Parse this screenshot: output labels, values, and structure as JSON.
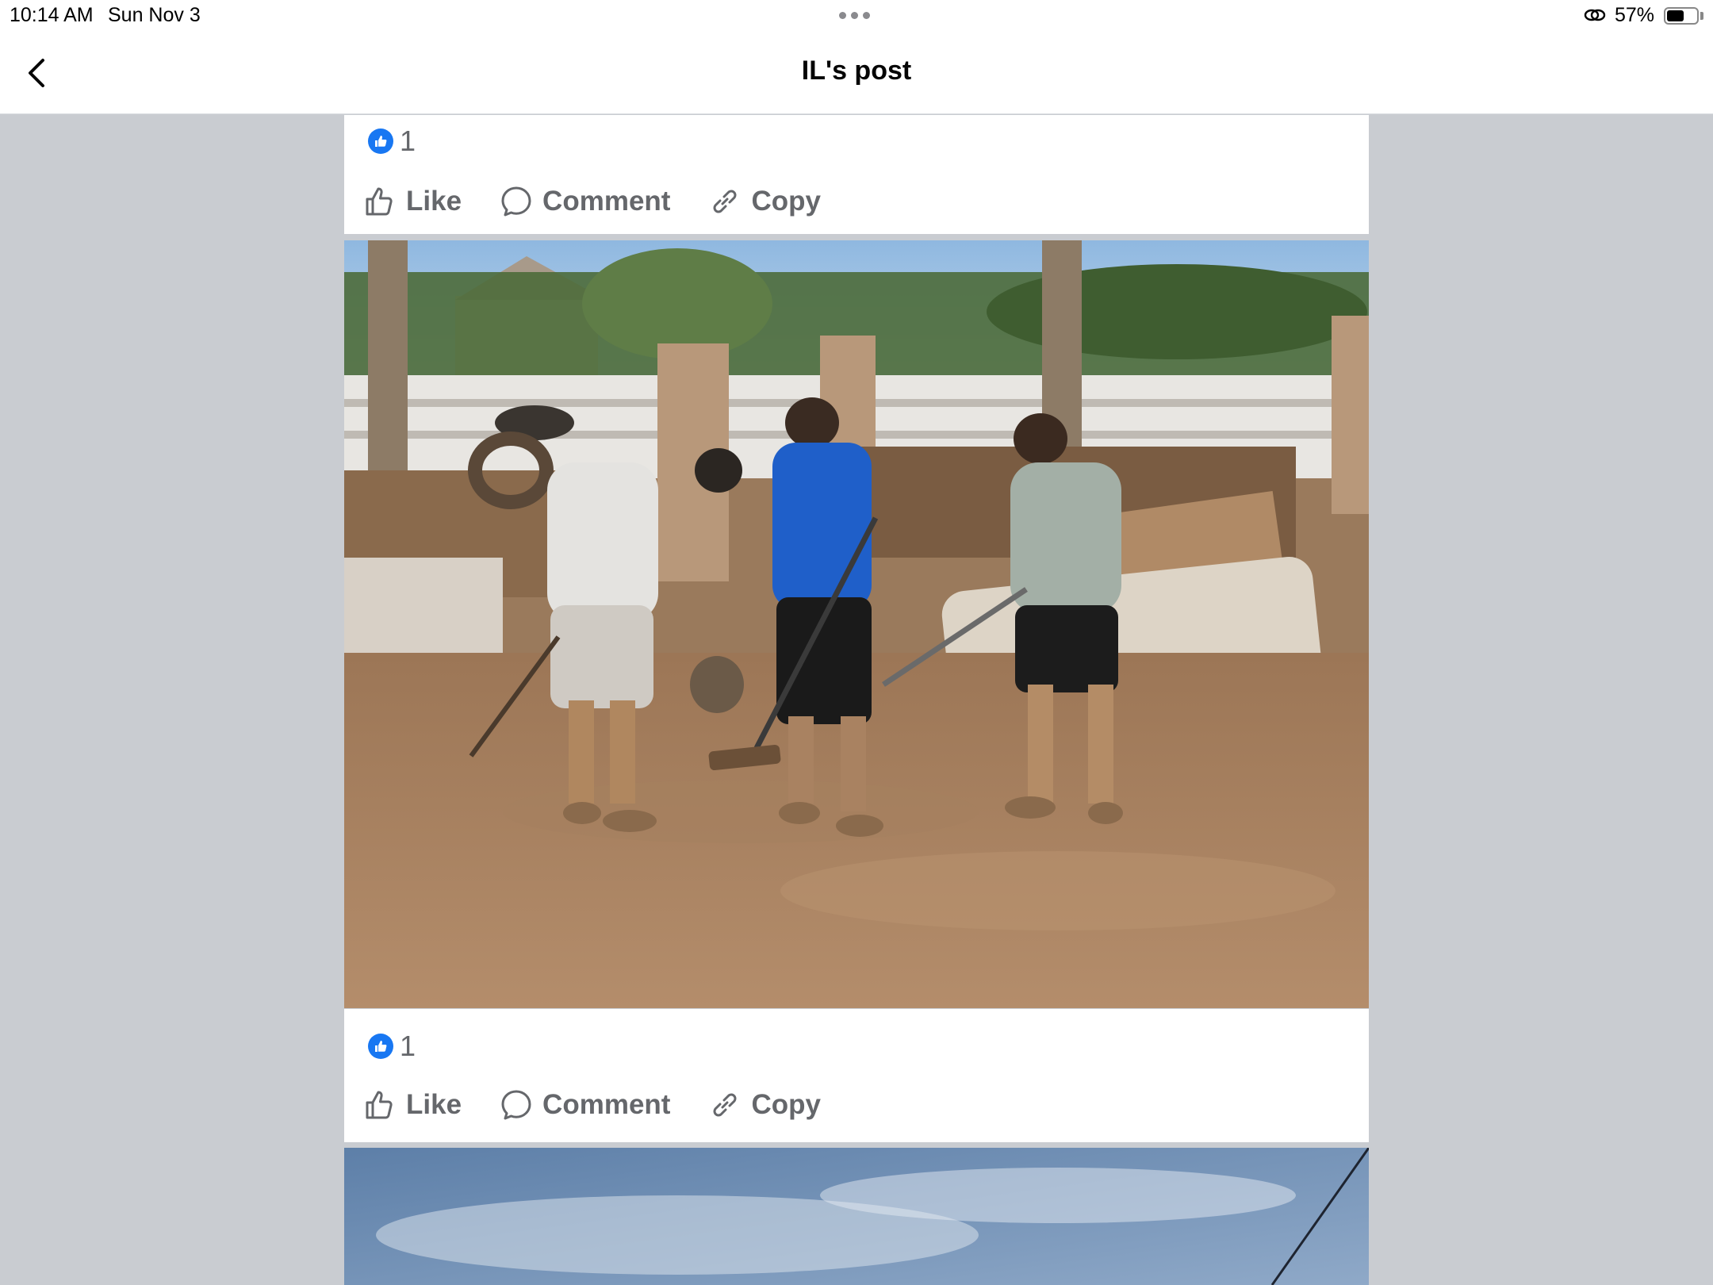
{
  "status_bar": {
    "time": "10:14 AM",
    "date": "Sun Nov 3",
    "battery_percent": "57%",
    "battery_level": 0.57
  },
  "header": {
    "title": "IL's post",
    "back_icon": "chevron-left-icon"
  },
  "posts": [
    {
      "reaction_count": "1",
      "actions": {
        "like": "Like",
        "comment": "Comment",
        "copy": "Copy"
      }
    },
    {
      "reaction_count": "1",
      "actions": {
        "like": "Like",
        "comment": "Comment",
        "copy": "Copy"
      }
    }
  ],
  "colors": {
    "accent": "#1877f2",
    "secondary_text": "#65676b",
    "page_background": "#c9ccd1"
  }
}
